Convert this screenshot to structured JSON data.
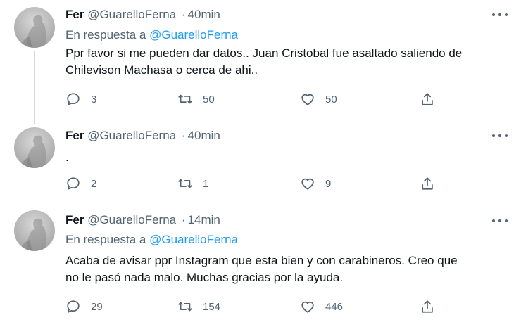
{
  "tweets": [
    {
      "display_name": "Fer",
      "handle": "@GuarelloFerna",
      "separator": "·",
      "time": "40min",
      "reply_prefix": "En respuesta a",
      "reply_handle": "@GuarelloFerna",
      "text_lines": [
        "Ppr favor si me pueden dar datos.. Juan Cristobal fue asaltado saliendo de",
        "Chilevison Machasa o cerca de ahi.."
      ],
      "replies": "3",
      "retweets": "50",
      "likes": "50"
    },
    {
      "display_name": "Fer",
      "handle": "@GuarelloFerna",
      "separator": "·",
      "time": "40min",
      "text_lines": [
        "."
      ],
      "replies": "2",
      "retweets": "1",
      "likes": "9"
    },
    {
      "display_name": "Fer",
      "handle": "@GuarelloFerna",
      "separator": "·",
      "time": "14min",
      "reply_prefix": "En respuesta a",
      "reply_handle": "@GuarelloFerna",
      "text_lines": [
        "Acaba de avisar ppr Instagram que esta bien y con carabineros. Creo que",
        "no le pasó nada malo. Muchas gracias por la ayuda."
      ],
      "replies": "29",
      "retweets": "154",
      "likes": "446"
    }
  ],
  "icons": {
    "reply": "reply-icon",
    "retweet": "retweet-icon",
    "like": "heart-icon",
    "share": "share-icon",
    "more": "more-icon"
  },
  "colors": {
    "link": "#1d9bf0",
    "secondary_text": "#536471",
    "primary_text": "#0f1419",
    "thread_line": "#cfd9de"
  }
}
